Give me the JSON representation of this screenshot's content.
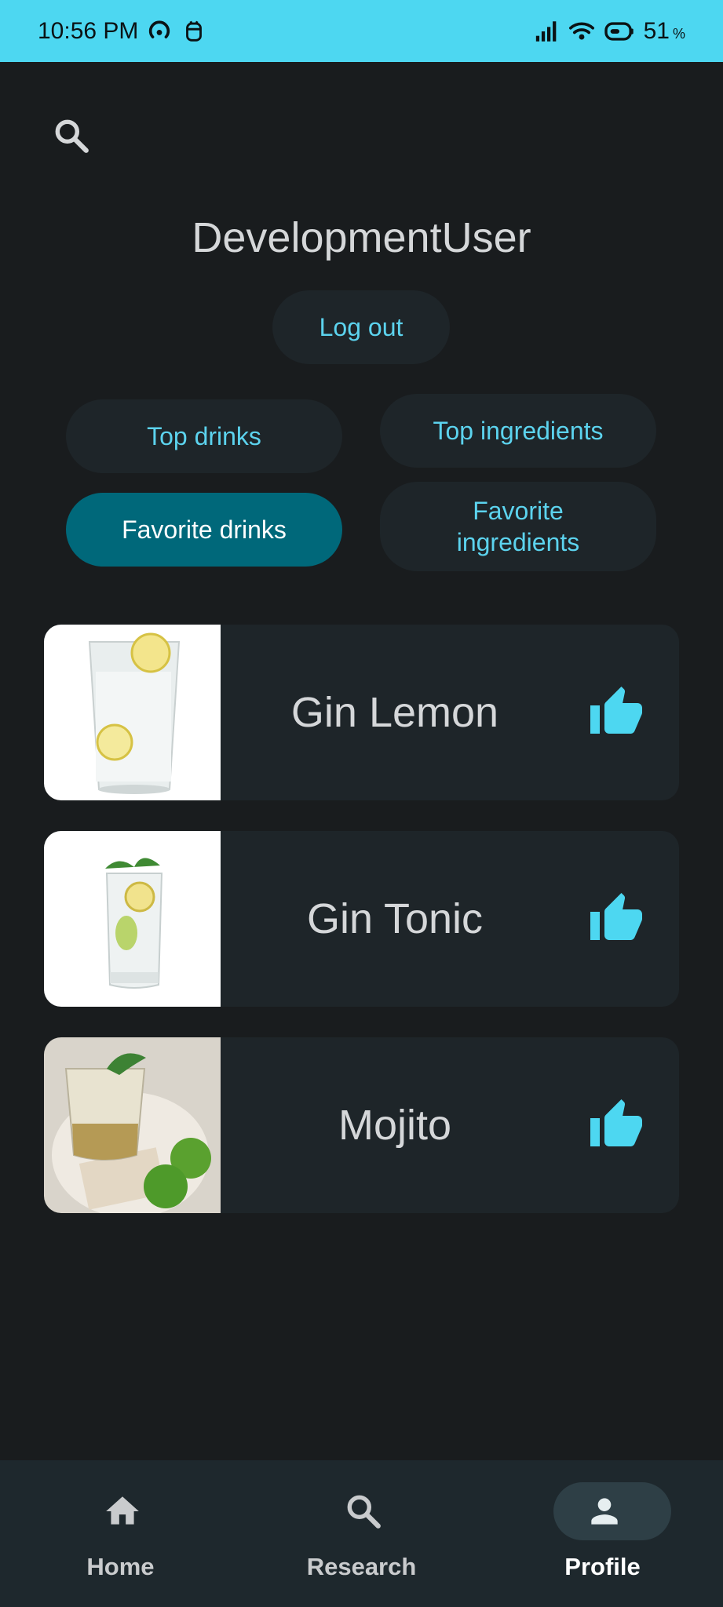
{
  "status_bar": {
    "time": "10:56 PM",
    "battery_value": "51",
    "battery_unit": "%"
  },
  "profile": {
    "username": "DevelopmentUser",
    "logout_label": "Log out"
  },
  "filters": {
    "top_drinks": "Top drinks",
    "top_ingredients": "Top ingredients",
    "favorite_drinks": "Favorite drinks",
    "favorite_ingredients": "Favorite ingredients",
    "selected": "favorite_drinks"
  },
  "drinks": [
    {
      "name": "Gin Lemon",
      "liked": true
    },
    {
      "name": "Gin Tonic",
      "liked": true
    },
    {
      "name": "Mojito",
      "liked": true
    }
  ],
  "bottom_nav": {
    "items": [
      {
        "label": "Home",
        "icon": "home-icon"
      },
      {
        "label": "Research",
        "icon": "search-icon"
      },
      {
        "label": "Profile",
        "icon": "person-icon",
        "active": true
      }
    ]
  },
  "colors": {
    "accent": "#5cd3ee",
    "status_bar": "#4dd7f1",
    "selected_pill": "#00687a",
    "background": "#191c1e",
    "card": "#1e2529"
  }
}
